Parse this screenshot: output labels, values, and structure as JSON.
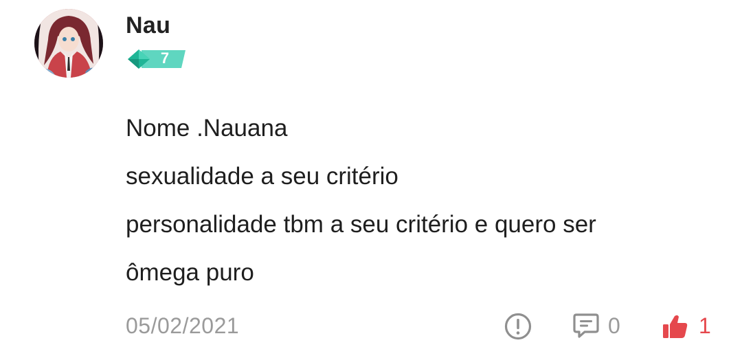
{
  "comment": {
    "author": {
      "name": "Nau",
      "level": "7"
    },
    "body_lines": [
      "Nome .Nauana",
      "sexualidade a seu critério",
      "personalidade tbm a seu critério e quero ser",
      "ômega puro"
    ],
    "date": "05/02/2021",
    "actions": {
      "report_icon": "exclamation-circle-icon",
      "reply_icon": "speech-bubble-icon",
      "reply_count": "0",
      "like_icon": "thumbs-up-icon",
      "like_count": "1"
    },
    "colors": {
      "level_badge": "#3cc9b0",
      "level_badge_dark": "#1fa98f",
      "like_active": "#e5484d",
      "muted": "#9a9a9a",
      "text": "#1e1e1e"
    }
  }
}
